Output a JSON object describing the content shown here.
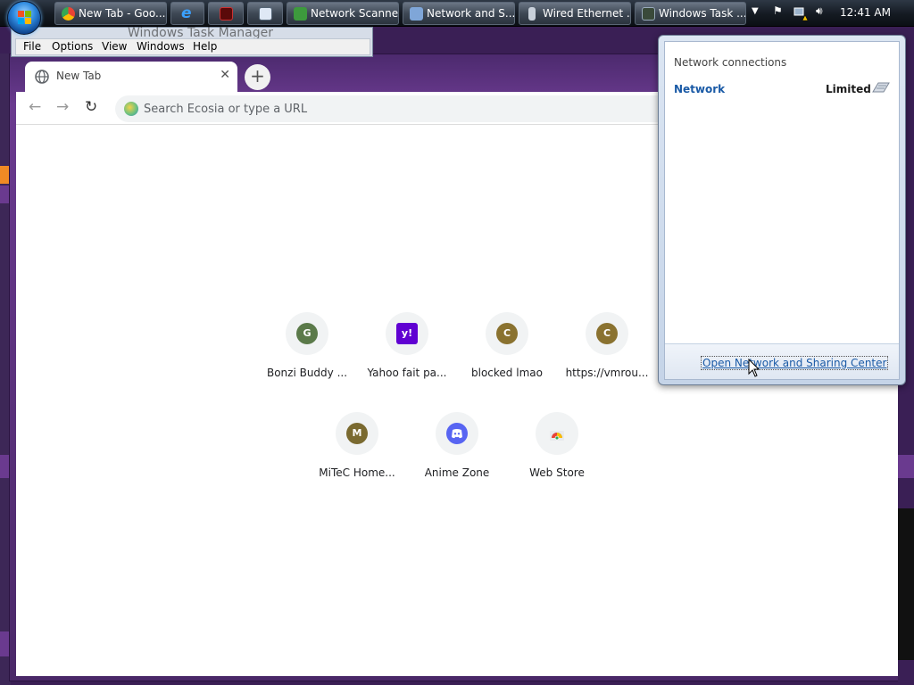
{
  "taskbar": {
    "items": [
      {
        "label": "New Tab - Goo...",
        "icon": "chrome-icon"
      },
      {
        "label": "",
        "icon": "internet-explorer-icon"
      },
      {
        "label": "",
        "icon": "app-icon-red"
      },
      {
        "label": "",
        "icon": "app-icon-blue"
      },
      {
        "label": "Network Scanner",
        "icon": "network-scanner-icon"
      },
      {
        "label": "Network and S...",
        "icon": "network-sharing-icon"
      },
      {
        "label": "Wired Ethernet ...",
        "icon": "ethernet-icon"
      },
      {
        "label": "Windows Task ...",
        "icon": "task-manager-icon"
      }
    ],
    "clock": "12:41 AM"
  },
  "task_manager": {
    "title": "Windows Task Manager",
    "menu": [
      "File",
      "Options",
      "View",
      "Windows",
      "Help"
    ]
  },
  "browser": {
    "tab_title": "New Tab",
    "omnibox_placeholder": "Search Ecosia or type a URL",
    "shortcuts": [
      {
        "label": "Bonzi Buddy ...",
        "letter": "G",
        "color": "#5b7a4a"
      },
      {
        "label": "Yahoo fait pa...",
        "letter": "y!",
        "color": "#6001d2"
      },
      {
        "label": "blocked lmao",
        "letter": "C",
        "color": "#8a7230"
      },
      {
        "label": "https://vmrou...",
        "letter": "C",
        "color": "#8a7230"
      },
      {
        "label": "MiTeC Home...",
        "letter": "M",
        "color": "#7a6a30"
      },
      {
        "label": "Anime Zone",
        "letter": "",
        "color": "#5865f2"
      },
      {
        "label": "Web Store",
        "letter": "",
        "color": "#ffffff"
      }
    ]
  },
  "network_flyout": {
    "header": "Network connections",
    "network_name": "Network",
    "status": "Limited",
    "link": "Open Network and Sharing Center"
  },
  "colors": {
    "taskbar": "#141a22",
    "link": "#1a5aa6",
    "theme_purple": "#4c2a6e"
  }
}
